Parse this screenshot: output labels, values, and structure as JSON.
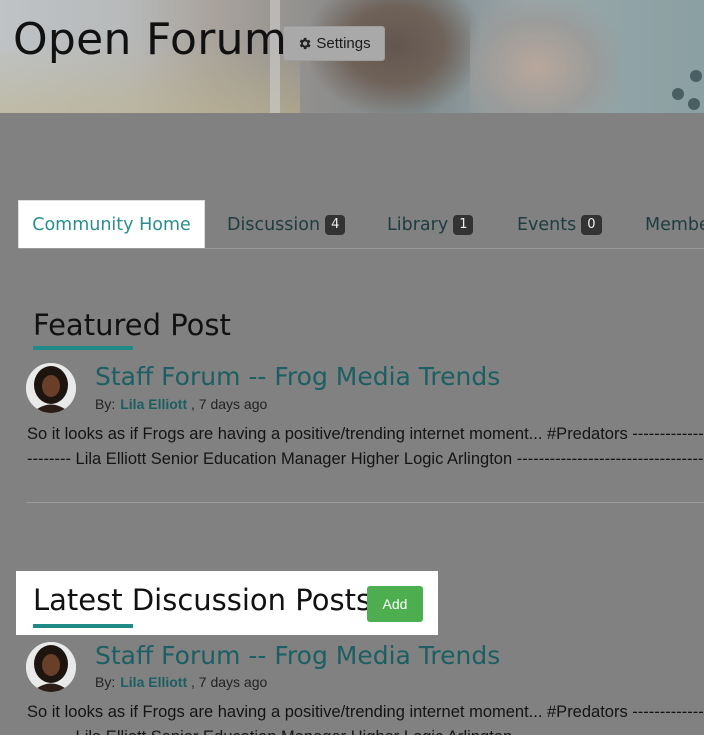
{
  "header": {
    "title": "Open Forum",
    "settings_label": "Settings"
  },
  "tabs": [
    {
      "label": "Community Home",
      "count": null,
      "active": true
    },
    {
      "label": "Discussion",
      "count": "4"
    },
    {
      "label": "Library",
      "count": "1"
    },
    {
      "label": "Events",
      "count": "0"
    },
    {
      "label": "Members",
      "count": null
    }
  ],
  "featured": {
    "heading": "Featured Post",
    "post": {
      "title": "Staff Forum -- Frog Media Trends",
      "by_label": "By:",
      "author": "Lila Elliott",
      "time": ", 7 days ago",
      "excerpt_line1": "So it looks as if Frogs are having a positive/trending internet moment... #Predators --------------",
      "excerpt_line2": "-------- Lila Elliott Senior Education Manager Higher Logic Arlington ------------------------------------"
    }
  },
  "latest": {
    "heading": "Latest Discussion Posts",
    "add_label": "Add",
    "post": {
      "title": "Staff Forum -- Frog Media Trends",
      "by_label": "By:",
      "author": "Lila Elliott",
      "time": ", 7 days ago",
      "excerpt_line1": "So it looks as if Frogs are having a positive/trending internet moment... #Predators --------------",
      "excerpt_line2": "-------- Lila Elliott Senior Education Manager Higher Logic Arlington ------------------------------------"
    }
  },
  "colors": {
    "accent": "#1f8a86",
    "link": "#1b5f62",
    "add_button": "#4cae4f"
  }
}
